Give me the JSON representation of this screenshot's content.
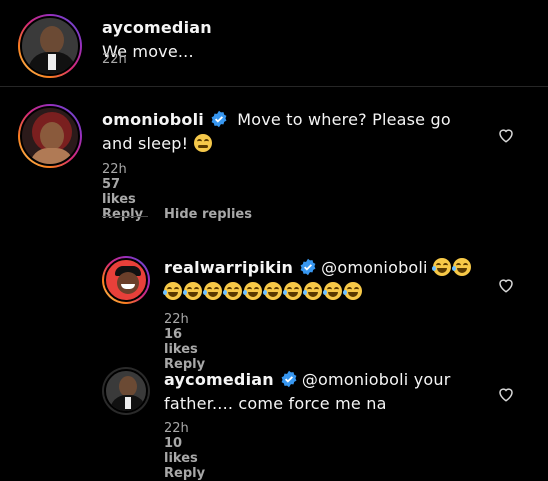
{
  "top_comment": {
    "username": "aycomedian",
    "text": "We move...",
    "time": "22h"
  },
  "comment": {
    "username": "omonioboli",
    "text_line1": "Move to where? Please go",
    "text_line2": "and sleep!",
    "emoji": "tired-face-emoji",
    "time": "22h",
    "likes": "57 likes",
    "reply": "Reply",
    "hide_replies": "Hide replies"
  },
  "replies": [
    {
      "username": "realwarripikin",
      "mention": "@omonioboli",
      "time": "22h",
      "likes": "16 likes",
      "reply": "Reply"
    },
    {
      "username": "aycomedian",
      "mention": "@omonioboli",
      "text_line1": "your",
      "text_line2": "father.... come force me na",
      "time": "22h",
      "likes": "10 likes",
      "reply": "Reply"
    }
  ],
  "colors": {
    "verified": "#3897f0",
    "meta": "#a8a8a8",
    "background": "#000000"
  }
}
